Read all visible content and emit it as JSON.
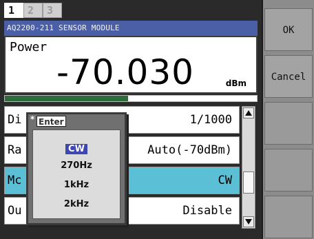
{
  "tabs": [
    "1",
    "2",
    "3"
  ],
  "module_title": "AQ2200-211 SENSOR MODULE",
  "readout": {
    "label": "Power",
    "value": "-70.030",
    "unit": "dBm"
  },
  "level_bar_fraction": 0.49,
  "menu_items": [
    {
      "name": "Di",
      "value": "1/1000"
    },
    {
      "name": "Ra",
      "value": "Auto(-70dBm)"
    },
    {
      "name": "Mc",
      "value": "CW",
      "selected": true
    },
    {
      "name": "Ou",
      "value": "Disable"
    }
  ],
  "popup": {
    "badge": "Enter",
    "marker": "*",
    "options": [
      "CW",
      "270Hz",
      "1kHz",
      "2kHz"
    ],
    "current": "CW"
  },
  "softkeys": {
    "ok": "OK",
    "cancel": "Cancel"
  },
  "colors": {
    "title_bar": "#4a5fa6",
    "selected_row": "#5bc0d6",
    "level_bar": "#2e6b3a",
    "popup_highlight": "#3e46b0"
  }
}
